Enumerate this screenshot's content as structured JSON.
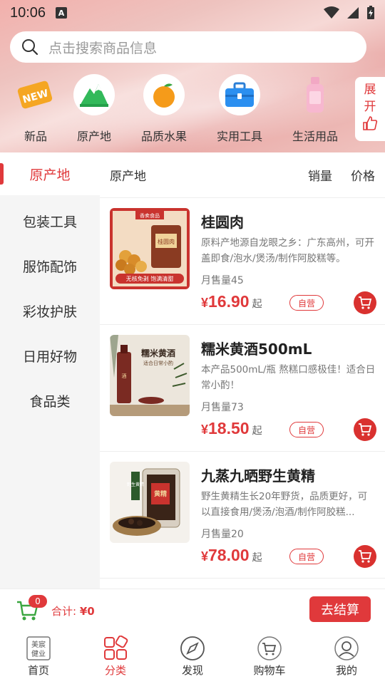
{
  "status": {
    "time": "10:06",
    "app_badge": "A"
  },
  "search": {
    "placeholder": "点击搜索商品信息"
  },
  "categories": [
    {
      "label": "新品",
      "icon": "new-badge-icon"
    },
    {
      "label": "原产地",
      "icon": "mountain-icon"
    },
    {
      "label": "品质水果",
      "icon": "orange-icon"
    },
    {
      "label": "实用工具",
      "icon": "toolbox-icon"
    },
    {
      "label": "生活用品",
      "icon": "bottle-icon"
    }
  ],
  "expand": {
    "line1": "展",
    "line2": "开"
  },
  "sidebar": {
    "items": [
      {
        "label": "原产地",
        "active": true
      },
      {
        "label": "包装工具"
      },
      {
        "label": "服饰配饰"
      },
      {
        "label": "彩妆护肤"
      },
      {
        "label": "日用好物"
      },
      {
        "label": "食品类"
      }
    ]
  },
  "listbar": {
    "title": "原产地",
    "sort_sales": "销量",
    "sort_price": "价格"
  },
  "products": [
    {
      "name": "桂圆肉",
      "desc": "原料产地源自龙眼之乡：广东高州，可开盖即食/泡水/煲汤/制作阿胶糕等。",
      "sold": "月售量45",
      "currency": "¥",
      "price": "16.90",
      "suffix": "起",
      "tag": "自营",
      "img_texts": {
        "top": "香卖食品",
        "jar": "桂圆肉",
        "banner": "无核免剥 饱满清甜"
      }
    },
    {
      "name": "糯米黄酒500mL",
      "desc": "本产品500mL/瓶 熬糕口感极佳！适合日常小酌！",
      "sold": "月售量73",
      "currency": "¥",
      "price": "18.50",
      "suffix": "起",
      "tag": "自营",
      "img_texts": {
        "title": "糯米黄酒",
        "sub": "适合日常小酌"
      }
    },
    {
      "name": "九蒸九晒野生黄精",
      "desc": "野生黄精生长20年野货，品质更好，可以直接食用/煲汤/泡酒/制作阿胶糕...",
      "sold": "月售量20",
      "currency": "¥",
      "price": "78.00",
      "suffix": "起",
      "tag": "自营",
      "img_texts": {
        "label": "野生黄精",
        "jar": "黄精"
      }
    }
  ],
  "checkout": {
    "badge": "0",
    "total_label": "合计:",
    "total_value": "¥0",
    "button": "去结算"
  },
  "tabs": [
    {
      "label": "首页",
      "icon": "home-logo-icon"
    },
    {
      "label": "分类",
      "icon": "category-grid-icon",
      "active": true
    },
    {
      "label": "发现",
      "icon": "compass-icon"
    },
    {
      "label": "购物车",
      "icon": "cart-icon"
    },
    {
      "label": "我的",
      "icon": "user-icon"
    }
  ],
  "logo_text": {
    "line1": "美宸",
    "line2": "健业"
  },
  "colors": {
    "accent": "#e0393b",
    "sidebar_bg": "#f5f5f5"
  }
}
